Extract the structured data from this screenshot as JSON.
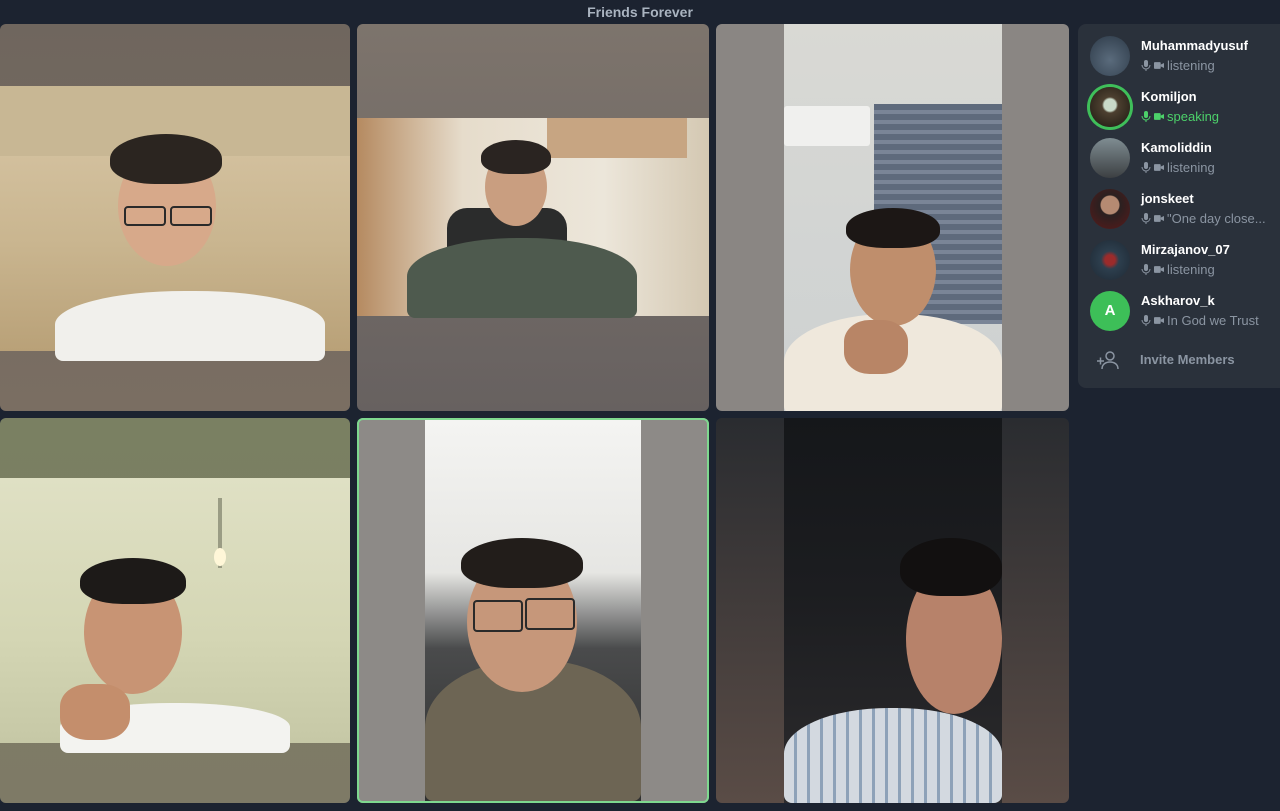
{
  "window": {
    "title": "Friends Forever"
  },
  "members": [
    {
      "name": "Muhammadyusuf",
      "status": "listening",
      "state": "listening"
    },
    {
      "name": "Komiljon",
      "status": "speaking",
      "state": "speaking"
    },
    {
      "name": "Kamoliddin",
      "status": "listening",
      "state": "listening"
    },
    {
      "name": "jonskeet",
      "status": "\"One day close...",
      "state": "listening"
    },
    {
      "name": "Mirzajanov_07",
      "status": "listening",
      "state": "listening"
    },
    {
      "name": "Askharov_k",
      "status": "In God we Trust",
      "state": "listening",
      "initial": "A"
    }
  ],
  "invite": {
    "label": "Invite Members"
  },
  "colors": {
    "speaking": "#4cd16a",
    "accent_border": "#7fd88f",
    "background": "#1c2330"
  }
}
